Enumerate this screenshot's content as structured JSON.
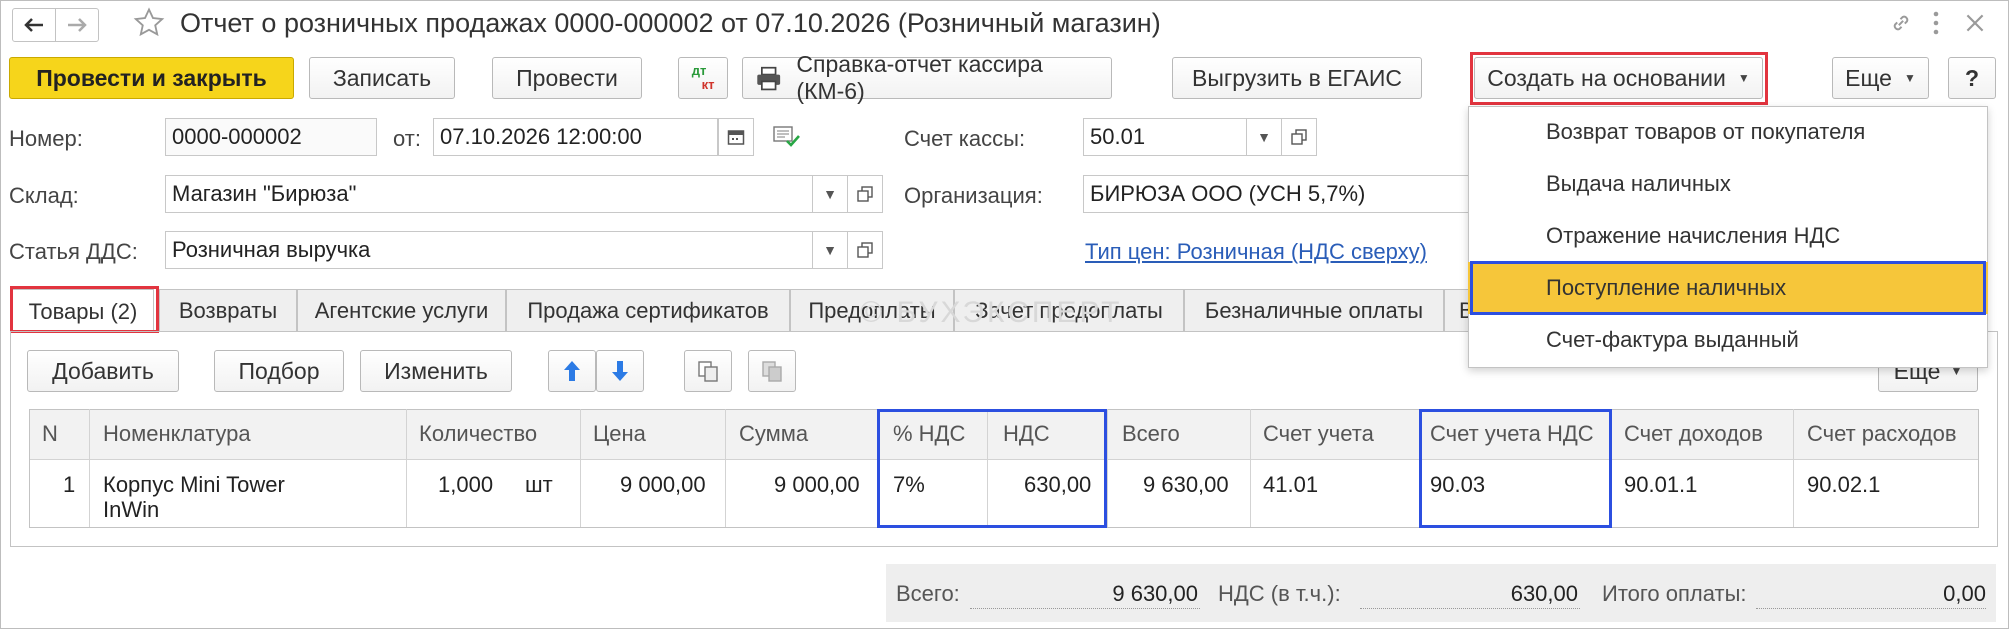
{
  "window": {
    "title": "Отчет о розничных продажах 0000-000002 от 07.10.2026 (Розничный магазин)"
  },
  "toolbar": {
    "post_close": "Провести и закрыть",
    "save": "Записать",
    "post": "Провести",
    "dtkt_top": "дт",
    "dtkt_bottom": "кт",
    "cashier_report": "Справка-отчет кассира (КМ-6)",
    "egais": "Выгрузить в ЕГАИС",
    "create_based": "Создать на основании",
    "more": "Еще",
    "help": "?"
  },
  "form": {
    "number_label": "Номер:",
    "number_value": "0000-000002",
    "date_label": "от:",
    "date_value": "07.10.2026 12:00:00",
    "cash_account_label": "Счет кассы:",
    "cash_account_value": "50.01",
    "warehouse_label": "Склад:",
    "warehouse_value": "Магазин \"Бирюза\"",
    "org_label": "Организация:",
    "org_value": "БИРЮЗА ООО (УСН 5,7%)",
    "dds_label": "Статья ДДС:",
    "dds_value": "Розничная выручка",
    "price_type_link": "Тип цен: Розничная (НДС сверху)"
  },
  "tabs": [
    "Товары (2)",
    "Возвраты",
    "Агентские услуги",
    "Продажа сертификатов",
    "Предоплаты",
    "Зачет предоплаты",
    "Безналичные оплаты",
    "В"
  ],
  "table_toolbar": {
    "add": "Добавить",
    "pick": "Подбор",
    "change": "Изменить",
    "more": "Еще"
  },
  "table": {
    "headers": [
      "N",
      "Номенклатура",
      "Количество",
      "Цена",
      "Сумма",
      "% НДС",
      "НДС",
      "Всего",
      "Счет учета",
      "Счет учета НДС",
      "Счет доходов",
      "Счет расходов"
    ],
    "rows": [
      {
        "n": "1",
        "item_line1": "Корпус Mini Tower",
        "item_line2": "InWin",
        "qty": "1,000",
        "unit": "шт",
        "price": "9 000,00",
        "sum": "9 000,00",
        "vat_rate": "7%",
        "vat": "630,00",
        "total": "9 630,00",
        "account": "41.01",
        "vat_account": "90.03",
        "income_account": "90.01.1",
        "expense_account": "90.02.1"
      }
    ]
  },
  "footer": {
    "total_label": "Всего:",
    "total_value": "9 630,00",
    "vat_label": "НДС (в т.ч.):",
    "vat_value": "630,00",
    "payment_label": "Итого оплаты:",
    "payment_value": "0,00"
  },
  "dropdown": {
    "items": [
      "Возврат товаров от покупателя",
      "Выдача наличных",
      "Отражение начисления НДС",
      "Поступление наличных",
      "Счет-фактура выданный"
    ],
    "selected_index": 3
  },
  "watermark": "© БУХЭКСПЕРТ"
}
